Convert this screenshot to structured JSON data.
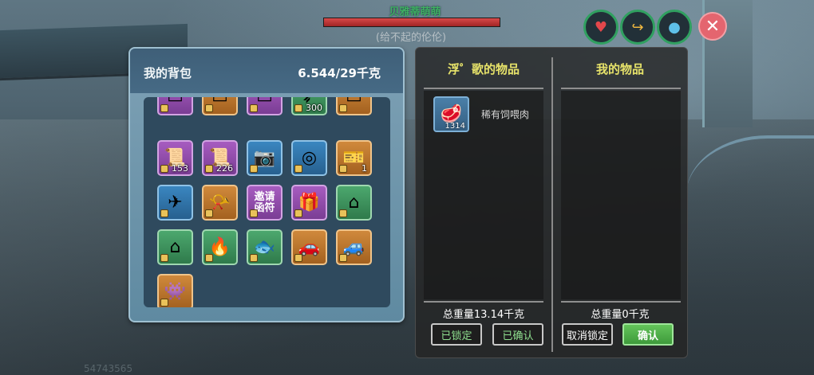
{
  "hud": {
    "target_name": "贝雅蒂萌萌",
    "target_hp_fraction": 1.0,
    "target_subtitle": "(给不起的伦伦)",
    "buttons": [
      {
        "icon": "heart-icon",
        "glyph": "♥"
      },
      {
        "icon": "arrow-icon",
        "glyph": "↪"
      },
      {
        "icon": "drop-icon",
        "glyph": "●"
      }
    ],
    "close_glyph": "✕",
    "corner_number": "54743565"
  },
  "backpack": {
    "title": "我的背包",
    "weight": "6.544/29千克",
    "rows": [
      [
        {
          "style": "purple",
          "glyph": "▭",
          "count": ""
        },
        {
          "style": "orange",
          "glyph": "▭",
          "count": ""
        },
        {
          "style": "purple",
          "glyph": "▭",
          "count": ""
        },
        {
          "style": "green",
          "glyph": "➶",
          "count": "300"
        },
        {
          "style": "orange",
          "glyph": "▭",
          "count": ""
        }
      ],
      [
        {
          "style": "purple",
          "glyph": "📜",
          "count": "153"
        },
        {
          "style": "purple",
          "glyph": "📜",
          "count": "226"
        },
        {
          "style": "blue",
          "glyph": "📷",
          "count": ""
        },
        {
          "style": "blue",
          "glyph": "◎",
          "count": ""
        },
        {
          "style": "orange",
          "glyph": "🎫",
          "count": "1"
        }
      ],
      [
        {
          "style": "blue",
          "glyph": "✈",
          "count": ""
        },
        {
          "style": "orange",
          "glyph": "📯",
          "count": ""
        },
        {
          "style": "purple",
          "glyph": "",
          "count": "",
          "label": "邀请函符"
        },
        {
          "style": "purple",
          "glyph": "🎁",
          "count": ""
        },
        {
          "style": "green",
          "glyph": "⌂",
          "count": ""
        }
      ],
      [
        {
          "style": "green",
          "glyph": "⌂",
          "count": ""
        },
        {
          "style": "green",
          "glyph": "🔥",
          "count": ""
        },
        {
          "style": "green",
          "glyph": "🐟",
          "count": ""
        },
        {
          "style": "orange",
          "glyph": "🚗",
          "count": ""
        },
        {
          "style": "orange",
          "glyph": "🚙",
          "count": ""
        }
      ],
      [
        {
          "style": "orange",
          "glyph": "👾",
          "count": ""
        }
      ]
    ]
  },
  "trade": {
    "left_title": "浮゜歌的物品",
    "right_title": "我的物品",
    "left_items": [
      {
        "name": "稀有饲喂肉",
        "glyph": "🥩",
        "count": "1314"
      }
    ],
    "left_total": "总重量13.14千克",
    "right_total": "总重量0千克",
    "left_buttons": [
      "已锁定",
      "已确认"
    ],
    "right_buttons": {
      "cancel": "取消锁定",
      "confirm": "确认"
    }
  }
}
